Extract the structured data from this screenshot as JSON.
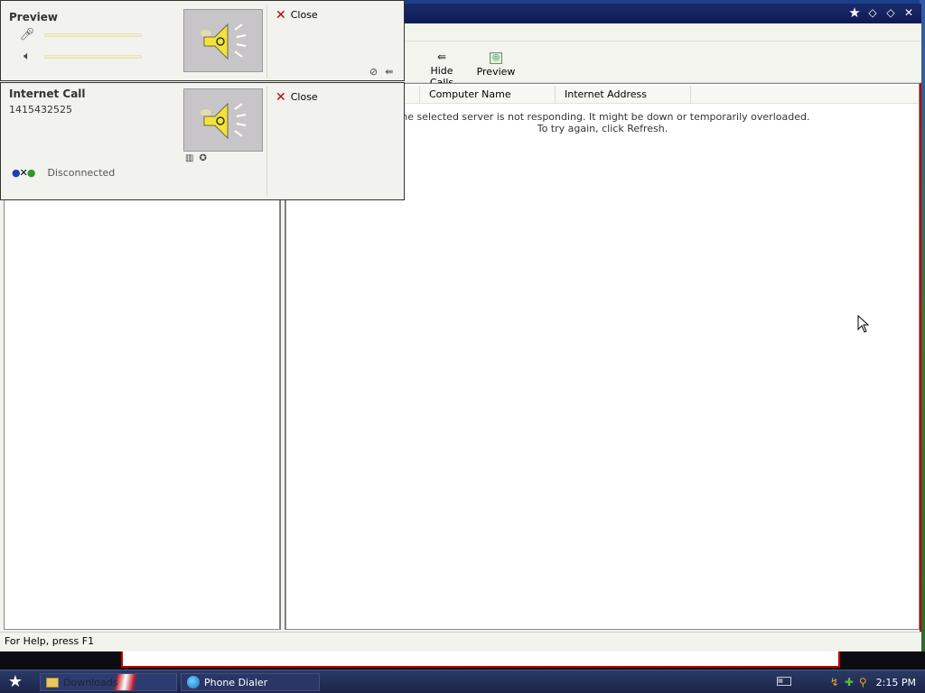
{
  "popup_preview": {
    "title": "Preview",
    "close_label": "Close",
    "close_icon": "close-x-icon",
    "mic_icon": "microphone-icon",
    "speaker_small_icon": "speaker-volume-icon",
    "speaker_graphic": "speaker-loud-icon",
    "bottom_icons": [
      "pin-icon",
      "back-arrow-icon"
    ]
  },
  "popup_call": {
    "title": "Internet Call",
    "number": "1415432525",
    "close_label": "Close",
    "status": "Disconnected",
    "status_icon": "disconnected-icon",
    "mini_icons": [
      "dialpad-icon",
      "add-participant-icon"
    ]
  },
  "main_window": {
    "title_controls": [
      "star-icon",
      "minimize-icon",
      "restore-icon",
      "close-icon"
    ]
  },
  "toolbar": {
    "hide_calls_label": "Hide Calls",
    "preview_label": "Preview"
  },
  "directory_list": {
    "columns": [
      "",
      "Computer Name",
      "Internet Address"
    ],
    "message_line1": "The selected server is not responding. It might be down or temporarily overloaded.",
    "message_line2": "To try again, click Refresh."
  },
  "statusbar": {
    "text": "For Help, press F1"
  },
  "taskbar": {
    "buttons": [
      {
        "label": "Downloads",
        "icon": "folder-icon"
      },
      {
        "label": "Phone Dialer",
        "icon": "phone-dialer-icon"
      }
    ],
    "clock": "2:15 PM",
    "tray_icons": [
      "keyboard-icon",
      "network-icon",
      "security-icon",
      "search-icon"
    ]
  },
  "colors": {
    "titlebar": "#0e1b55",
    "close_x": "#b00000",
    "taskbar": "#1a2448"
  }
}
